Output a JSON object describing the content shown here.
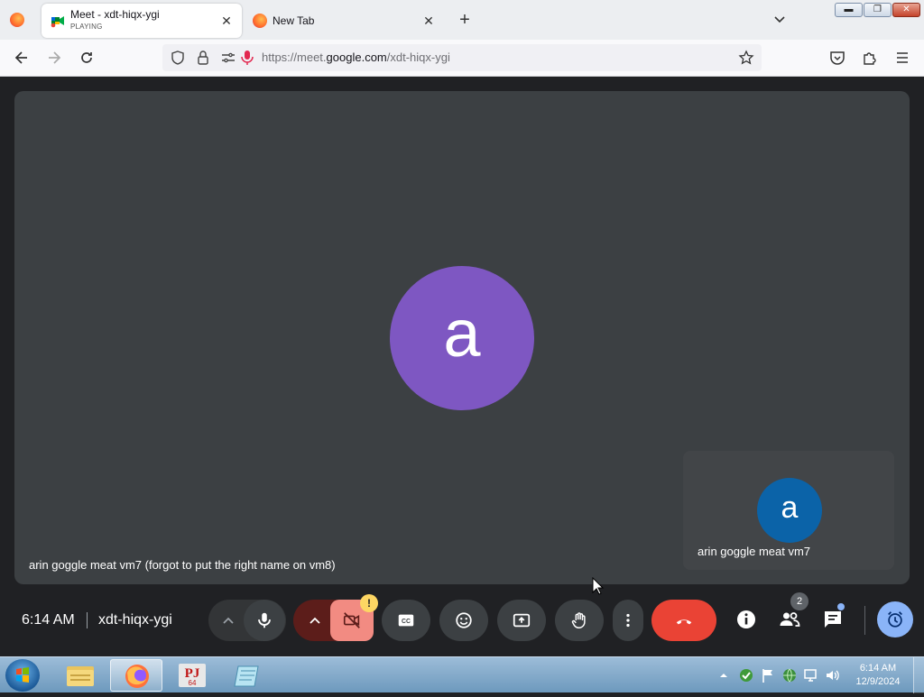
{
  "browser": {
    "tabs": [
      {
        "title": "Meet - xdt-hiqx-ygi",
        "status": "PLAYING"
      },
      {
        "title": "New Tab"
      }
    ],
    "url_prefix": "https://meet.",
    "url_domain": "google.com",
    "url_path": "/xdt-hiqx-ygi"
  },
  "meet": {
    "main_avatar_letter": "a",
    "main_name": "arin goggle meat vm7 (forgot to put the right name on vm8)",
    "self_avatar_letter": "a",
    "self_name": "arin goggle meat vm7",
    "time": "6:14 AM",
    "meeting_code": "xdt-hiqx-ygi",
    "camera_warning": "!",
    "participant_count": "2"
  },
  "taskbar": {
    "pinned": [
      "windows-explorer",
      "firefox",
      "pj64",
      "notepad"
    ],
    "pj_label": "PJ",
    "pj_sub": "64",
    "clock_time": "6:14 AM",
    "clock_date": "12/9/2024"
  },
  "colors": {
    "main_avatar": "#7e57c2",
    "self_avatar": "#0b63a8",
    "end_call": "#ea4335",
    "camera_off": "#f28b82"
  }
}
